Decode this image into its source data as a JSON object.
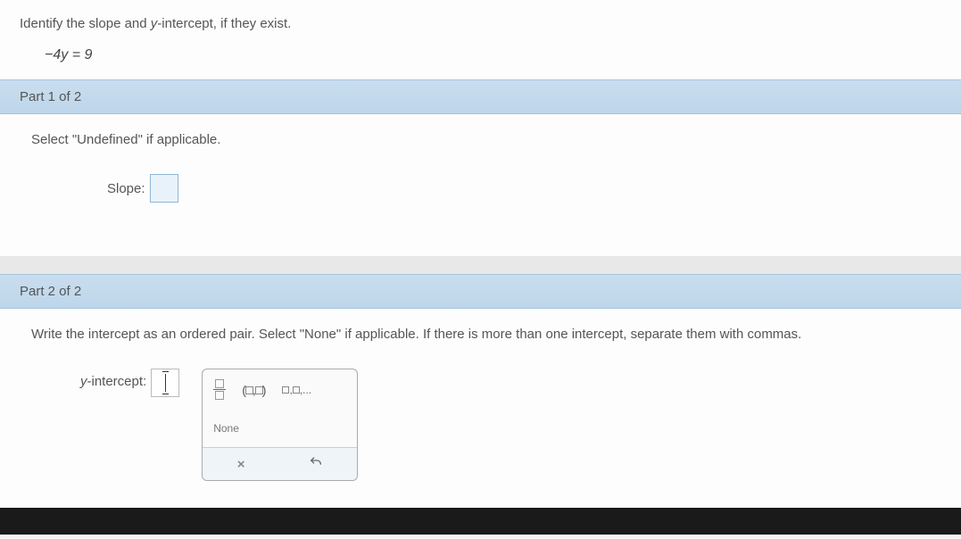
{
  "question": {
    "prompt_pre": "Identify the slope and ",
    "prompt_var": "y",
    "prompt_post": "-intercept, if they exist.",
    "equation": "−4y = 9"
  },
  "part1": {
    "header": "Part 1 of 2",
    "instruction": "Select \"Undefined\" if applicable.",
    "label": "Slope:"
  },
  "part2": {
    "header": "Part 2 of 2",
    "instruction": "Write the intercept as an ordered pair. Select \"None\" if applicable. If there is more than one intercept, separate them with commas.",
    "label_var": "y",
    "label_post": "-intercept:"
  },
  "toolbox": {
    "none": "None",
    "clear": "×"
  }
}
